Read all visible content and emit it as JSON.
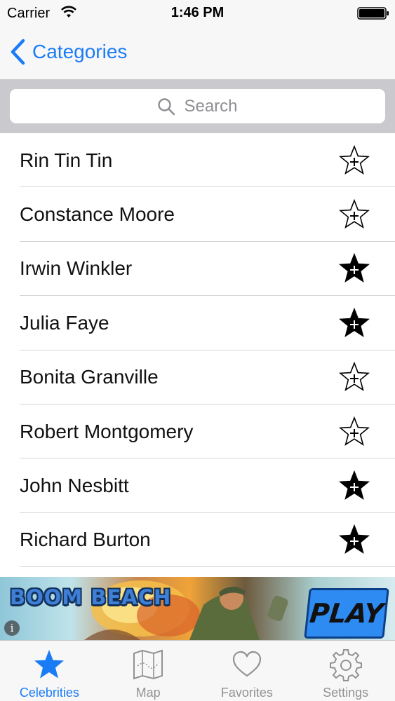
{
  "status_bar": {
    "carrier": "Carrier",
    "time": "1:46 PM",
    "icons": [
      "wifi-icon",
      "battery-icon"
    ]
  },
  "nav": {
    "back_label": "Categories",
    "back_icon": "chevron-left-icon",
    "accent_color": "#1a7cf5"
  },
  "search": {
    "placeholder": "Search",
    "icon": "search-icon"
  },
  "list": {
    "items": [
      {
        "name": "Rin Tin Tin",
        "favorite": false
      },
      {
        "name": "Constance Moore",
        "favorite": false
      },
      {
        "name": "Irwin Winkler",
        "favorite": true
      },
      {
        "name": "Julia Faye",
        "favorite": true
      },
      {
        "name": "Bonita Granville",
        "favorite": false
      },
      {
        "name": "Robert Montgomery",
        "favorite": false
      },
      {
        "name": "John Nesbitt",
        "favorite": true
      },
      {
        "name": "Richard Burton",
        "favorite": true
      }
    ]
  },
  "ad": {
    "brand": "BOOM BEACH",
    "cta": "PLAY",
    "info_glyph": "i"
  },
  "tabs": [
    {
      "label": "Celebrities",
      "icon": "star-icon",
      "active": true
    },
    {
      "label": "Map",
      "icon": "map-icon",
      "active": false
    },
    {
      "label": "Favorites",
      "icon": "heart-icon",
      "active": false
    },
    {
      "label": "Settings",
      "icon": "gear-icon",
      "active": false
    }
  ]
}
